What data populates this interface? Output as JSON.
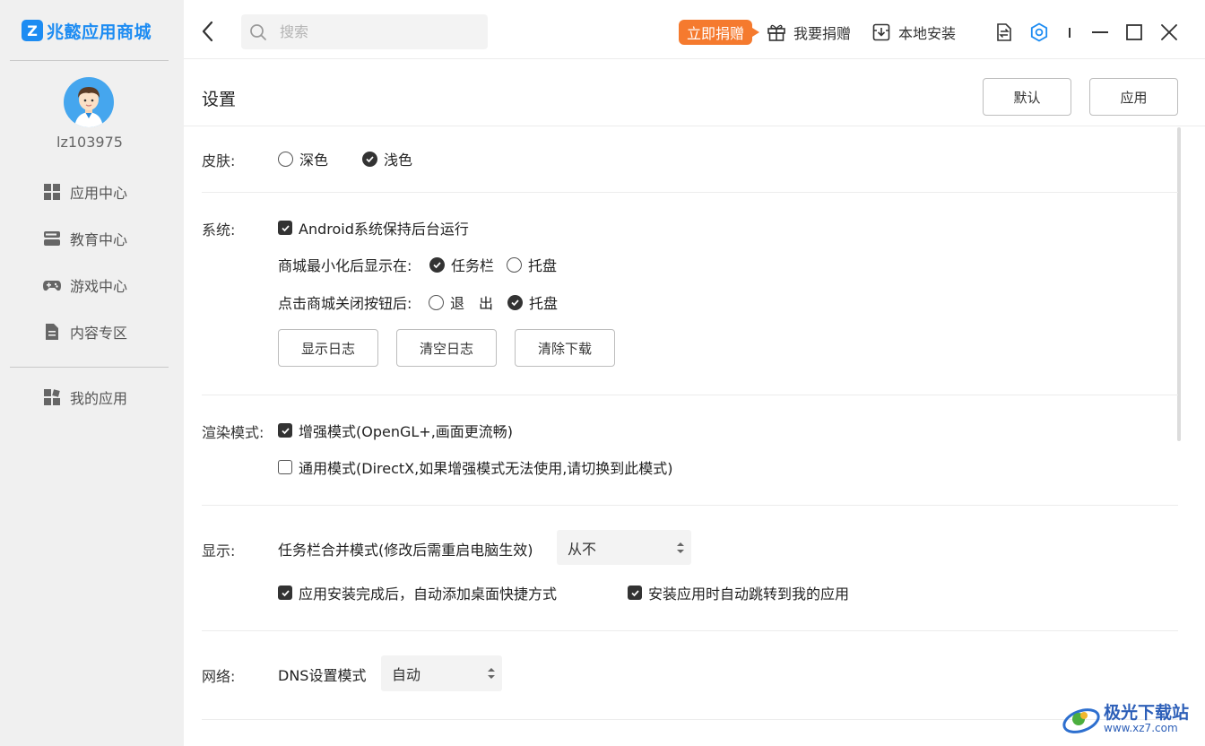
{
  "app": {
    "logo_mark": "Z",
    "title": "兆懿应用商城"
  },
  "user": {
    "name": "lz103975"
  },
  "sidebar": {
    "items": [
      {
        "label": "应用中心",
        "icon": "grid-icon"
      },
      {
        "label": "教育中心",
        "icon": "book-icon"
      },
      {
        "label": "游戏中心",
        "icon": "gamepad-icon"
      },
      {
        "label": "内容专区",
        "icon": "document-icon"
      }
    ],
    "my_apps": {
      "label": "我的应用",
      "icon": "grid-icon"
    }
  },
  "topbar": {
    "search_placeholder": "搜索",
    "donate_now": "立即捐赠",
    "donate": "我要捐赠",
    "local_install": "本地安装",
    "accent_color": "#1d8cf2",
    "donate_color": "#f57a2e"
  },
  "page": {
    "title": "设置",
    "default_btn": "默认",
    "apply_btn": "应用"
  },
  "skin": {
    "label": "皮肤:",
    "options": [
      {
        "label": "深色",
        "selected": false
      },
      {
        "label": "浅色",
        "selected": true
      }
    ]
  },
  "system": {
    "label": "系统:",
    "keep_running": {
      "label": "Android系统保持后台运行",
      "checked": true
    },
    "minimize_label": "商城最小化后显示在:",
    "minimize_options": [
      {
        "label": "任务栏",
        "selected": true
      },
      {
        "label": "托盘",
        "selected": false
      }
    ],
    "close_label": "点击商城关闭按钮后:",
    "close_options": [
      {
        "label": "退　出",
        "selected": false
      },
      {
        "label": "托盘",
        "selected": true
      }
    ],
    "buttons": [
      "显示日志",
      "清空日志",
      "清除下载"
    ]
  },
  "render": {
    "label": "渲染模式:",
    "options": [
      {
        "label": "增强模式(OpenGL+,画面更流畅)",
        "checked": true
      },
      {
        "label": "通用模式(DirectX,如果增强模式无法使用,请切换到此模式)",
        "checked": false
      }
    ]
  },
  "display": {
    "label": "显示:",
    "taskbar_merge_label": "任务栏合并模式(修改后需重启电脑生效)",
    "taskbar_merge_value": "从不",
    "shortcut": {
      "label": "应用安装完成后，自动添加桌面快捷方式",
      "checked": true
    },
    "jump": {
      "label": "安装应用时自动跳转到我的应用",
      "checked": true
    }
  },
  "network": {
    "label": "网络:",
    "dns_label": "DNS设置模式",
    "dns_value": "自动"
  },
  "watermark": {
    "text": "极光下载站",
    "url": "www.xz7.com"
  }
}
